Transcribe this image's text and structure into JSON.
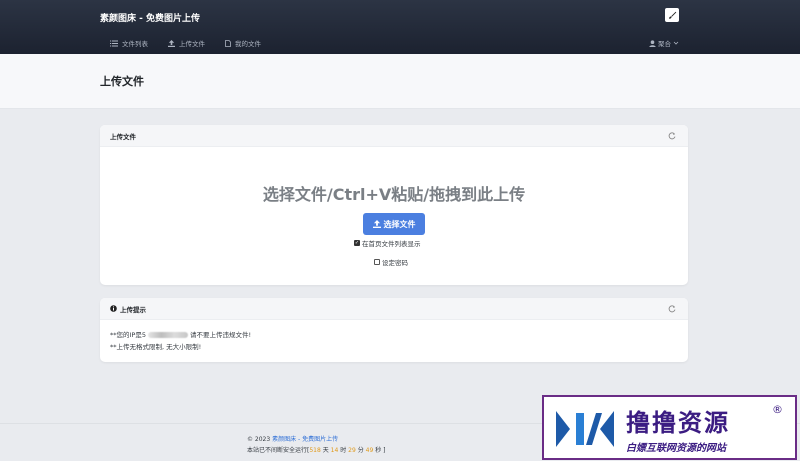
{
  "app": {
    "brand": "素颜图床 - 免费图片上传"
  },
  "nav": {
    "items": [
      {
        "label": "文件列表",
        "icon": "list-icon"
      },
      {
        "label": "上传文件",
        "icon": "upload-icon"
      },
      {
        "label": "我的文件",
        "icon": "file-icon"
      }
    ],
    "user": "聚合"
  },
  "page": {
    "title": "上传文件"
  },
  "upload_card": {
    "title": "上传文件",
    "heading": "选择文件/Ctrl+V粘贴/拖拽到此上传",
    "button": "选择文件",
    "option_show": "在首页文件列表显示",
    "option_show_checked": true,
    "option_password": "设定密码",
    "option_password_checked": false
  },
  "tips_card": {
    "title": "上传提示",
    "line1_prefix": "**您的IP是5",
    "line1_suffix": "请不要上传违规文件!",
    "line2": "**上传无格式限制, 无大小限制!"
  },
  "footer": {
    "copyright": "© 2023 ",
    "site_link": "素颜图床 - 免费图片上传",
    "uptime_prefix": "本站已不间断安全运行[",
    "days": "518",
    "days_unit": "天",
    "hours": "14",
    "hours_unit": "时",
    "minutes": "29",
    "minutes_unit": "分",
    "seconds": "49",
    "seconds_unit": "秒",
    "uptime_suffix": "]"
  },
  "watermark": {
    "title": "撸撸资源",
    "registered": "®",
    "subtitle": "白嫖互联网资源的网站"
  },
  "colors": {
    "topbar": "#1f2532",
    "accent": "#4b7fe0",
    "link": "#2f6fd6",
    "number": "#e09a1a",
    "watermark": "#3b1c82"
  }
}
